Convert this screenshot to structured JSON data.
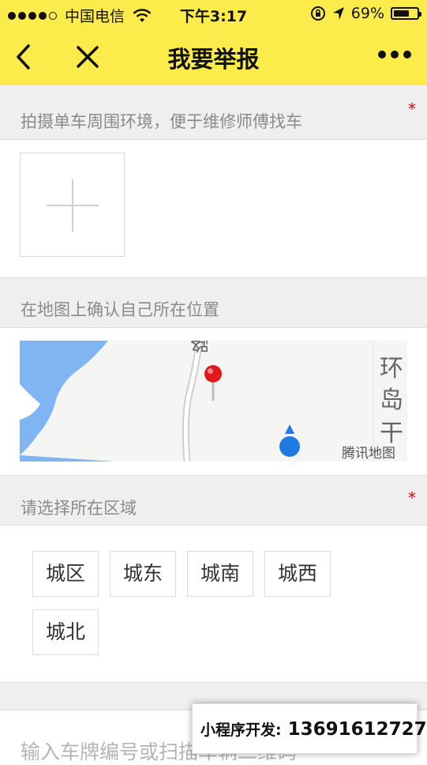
{
  "status_bar": {
    "carrier": "中国电信",
    "time": "下午3:17",
    "battery": "69%",
    "battery_level": 0.69
  },
  "nav": {
    "title": "我要举报"
  },
  "photo_section": {
    "label": "拍摄单车周围环境，便于维修师傅找车",
    "required_mark": "*"
  },
  "map_section": {
    "label": "在地图上确认自己所在位置",
    "map_labels": {
      "road_top": "路",
      "road_right_1": "环",
      "road_right_2": "岛",
      "road_right_3": "干",
      "watermark": "腾讯地图"
    }
  },
  "region_section": {
    "label": "请选择所在区域",
    "required_mark": "*",
    "options": [
      "城区",
      "城东",
      "城南",
      "城西",
      "城北"
    ]
  },
  "plate_input": {
    "placeholder": "输入车牌编号或扫描车辆二维码"
  },
  "dev_badge": {
    "label": "小程序开发:",
    "phone": "13691612727"
  }
}
